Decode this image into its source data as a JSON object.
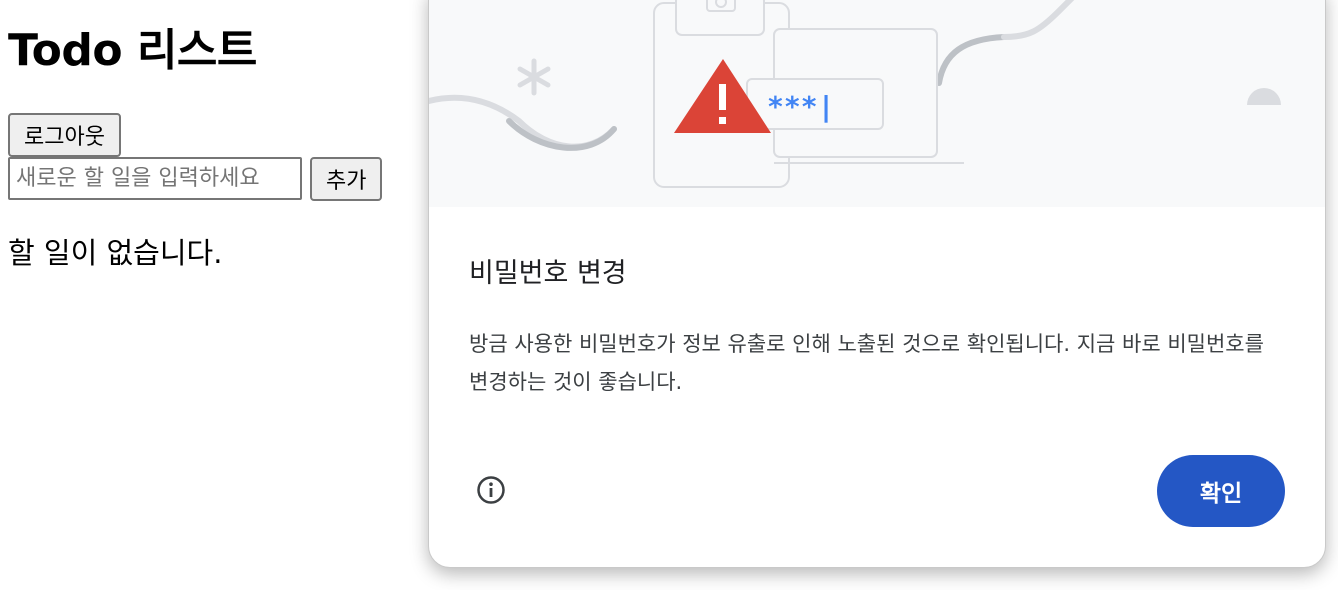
{
  "page": {
    "title": "Todo 리스트",
    "logout_label": "로그아웃",
    "new_todo_placeholder": "새로운 할 일을 입력하세요",
    "add_label": "추가",
    "empty_message": "할 일이 없습니다."
  },
  "dialog": {
    "illustration_text": "***|",
    "title": "비밀번호 변경",
    "body": "방금 사용한 비밀번호가 정보 유출로 인해 노출된 것으로 확인됩니다. 지금 바로 비밀번호를 변경하는 것이 좋습니다.",
    "info_icon": "info-icon",
    "confirm_label": "확인",
    "colors": {
      "accent": "#2457c5",
      "warning": "#db4437",
      "illustration_bg": "#f8f9fa"
    }
  }
}
